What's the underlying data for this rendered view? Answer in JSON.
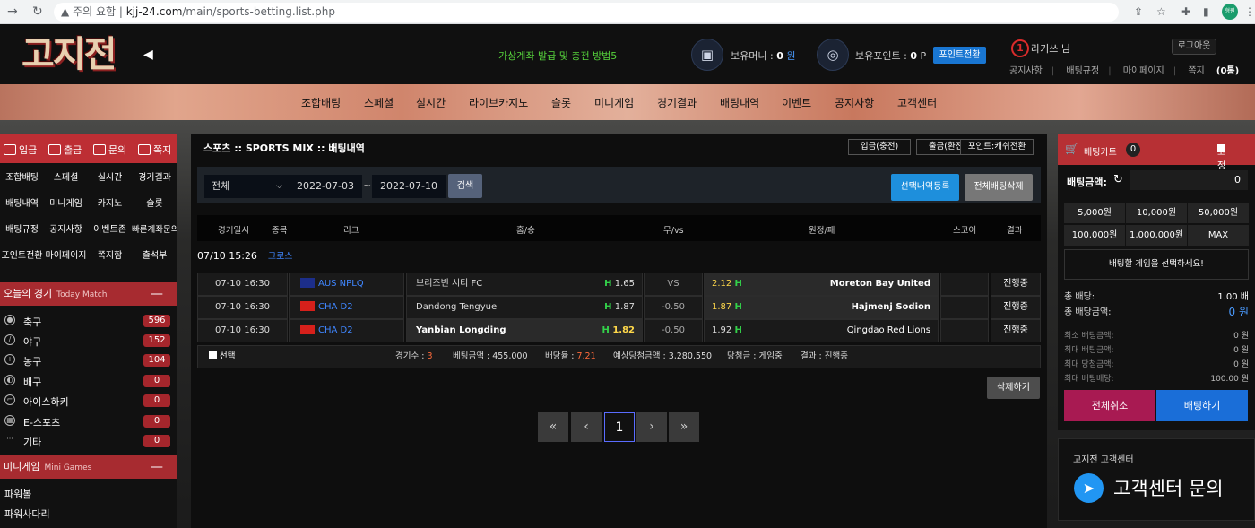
{
  "browser": {
    "warning": "주의 요함",
    "url_domain": "kjj-24.com",
    "url_path": "/main/sports-betting.list.php",
    "profile": "형원"
  },
  "header": {
    "logo": "고지전",
    "marquee": "가상계좌 발급 및 충전 방법5",
    "money_label": "보유머니 : ",
    "money_value": "0",
    "money_unit": "원",
    "point_label": "보유포인트 : ",
    "point_value": "0",
    "point_unit": "P",
    "point_convert": "포인트전환",
    "level": "1",
    "username": "라기쓰 님",
    "logout": "로그아웃",
    "links": [
      "공지사항",
      "배팅규정",
      "마이페이지"
    ],
    "msg_label": "쪽지",
    "msg_count": "(0통)"
  },
  "menu": [
    "조합배팅",
    "스페셜",
    "실시간",
    "라이브카지노",
    "슬롯",
    "미니게임",
    "경기결과",
    "배팅내역",
    "이벤트",
    "공지사항",
    "고객센터"
  ],
  "left": {
    "quick": [
      "입금",
      "출금",
      "문의",
      "쪽지"
    ],
    "grid": [
      "조합배팅",
      "스페셜",
      "실시간",
      "경기결과",
      "배팅내역",
      "미니게임",
      "카지노",
      "슬롯",
      "배팅규정",
      "공지사항",
      "이벤트존",
      "빠른계좌문의",
      "포인트전환",
      "마이페이지",
      "쪽지함",
      "출석부"
    ],
    "today_title": "오늘의 경기",
    "today_sub": "Today Match",
    "sports": [
      {
        "name": "축구",
        "count": "596"
      },
      {
        "name": "야구",
        "count": "152"
      },
      {
        "name": "농구",
        "count": "104"
      },
      {
        "name": "배구",
        "count": "0"
      },
      {
        "name": "아이스하키",
        "count": "0"
      },
      {
        "name": "E-스포츠",
        "count": "0"
      },
      {
        "name": "기타",
        "count": "0"
      }
    ],
    "mini_title": "미니게임",
    "mini_sub": "Mini Games",
    "mini": [
      "파워볼",
      "파워사다리"
    ]
  },
  "main": {
    "breadcrumb": "스포츠 :: SPORTS MIX :: 배팅내역",
    "top_buttons": [
      "입금(충전)",
      "출금(환전)",
      "포인트:캐쉬전환"
    ],
    "filter_select": "전체",
    "date_from": "2022-07-03",
    "date_sep": "~",
    "date_to": "2022-07-10",
    "search": "검색",
    "register_btn": "선택내역등록",
    "delete_all_btn": "전체배팅삭제",
    "columns": [
      "경기일시",
      "종목",
      "리그",
      "홈/승",
      "무/vs",
      "원정/패",
      "스코어",
      "결과"
    ],
    "group": {
      "date": "07/10  15:26",
      "type": "크로스"
    },
    "rows": [
      {
        "time": "07-10 16:30",
        "league": "AUS NPLQ",
        "home": "브리즈번 시티 FC",
        "home_odd": "1.65",
        "mid": "VS",
        "away_odd": "2.12",
        "away": "Moreton Bay United",
        "score": "",
        "result": "진행중"
      },
      {
        "time": "07-10 16:30",
        "league": "CHA D2",
        "home": "Dandong Tengyue",
        "home_odd": "1.87",
        "mid": "-0.50",
        "away_odd": "1.87",
        "away": "Hajmenj Sodion",
        "score": "",
        "result": "진행중"
      },
      {
        "time": "07-10 16:30",
        "league": "CHA D2",
        "home": "Yanbian Longding",
        "home_odd": "1.82",
        "mid": "-0.50",
        "away_odd": "1.92",
        "away": "Qingdao Red Lions",
        "score": "",
        "result": "진행중"
      }
    ],
    "h": "H",
    "summary": {
      "select": "선택",
      "games_label": "경기수 : ",
      "games": "3",
      "bet_label": "베팅금액 : ",
      "bet": "455,000",
      "odds_label": "배당율 : ",
      "odds": "7.21",
      "expected_label": "예상당첨금액 : ",
      "expected": "3,280,550",
      "win_label": "당첨금 : ",
      "win": "게임중",
      "result_label": "결과 : ",
      "result": "진행중"
    },
    "delete_btn": "삭제하기",
    "pager": [
      "«",
      "‹",
      "1",
      "›",
      "»"
    ]
  },
  "right": {
    "cart_title": "배팅카트",
    "cart_count": "0",
    "fixed": "고정",
    "bet_amount_label": "배팅금액:",
    "bet_amount": "0",
    "amounts": [
      "5,000원",
      "10,000원",
      "50,000원",
      "100,000원",
      "1,000,000원",
      "MAX"
    ],
    "select_msg": "배팅할 게임을 선택하세요!",
    "total_odds_label": "총 배당:",
    "total_odds": "1.00 배",
    "total_amount_label": "총 배당금액:",
    "total_amount": "0 원",
    "limits": [
      {
        "label": "최소 배팅금액:",
        "value": "0 원"
      },
      {
        "label": "최대 배팅금액:",
        "value": "0 원"
      },
      {
        "label": "최대 당첨금액:",
        "value": "0 원"
      },
      {
        "label": "최대 배팅배당:",
        "value": "100.00 원"
      }
    ],
    "cancel_all": "전체취소",
    "place_bet": "배팅하기",
    "cs_title": "고지전 고객센터",
    "cs_big": "고객센터 문의"
  },
  "colors": {
    "red": "#bd2e34",
    "blue": "#1976d2",
    "green": "#33d24a",
    "yellow": "#ffd84a"
  }
}
